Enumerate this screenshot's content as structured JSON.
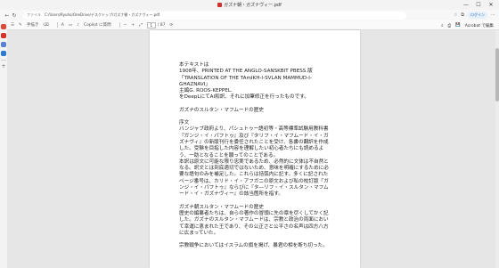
{
  "window": {
    "title": "ガズナ朝・ガズナヴィー.pdf",
    "controls": [
      "—",
      "☐",
      "✕"
    ]
  },
  "address": {
    "label": "ファイル",
    "url": "C:/Users/Ryuho/OneDrive/デスクトップ/ガズナ朝・ガズナヴィー.pdf",
    "login_label": "ログイン"
  },
  "toolbar": {
    "highlight": "手描き",
    "page_current": "1",
    "page_total": "/ 87",
    "zoom_minus": "−",
    "zoom_plus": "+",
    "copilot": "Copilot に質問",
    "acrobat": "Acrobat で編集"
  },
  "document": {
    "lines": [
      "本テキストは",
      "1908年、PRINTED AT THE ANGLO-SANSKBIT PBESS.版",
      "「TRANSLATION OF THE TAmIKH-I-SVLAN MAMMUD-I-GHAZNAVI」",
      "主編G. ROOS-KEPPEL.",
      "をDeepLにてAI和訳、それに加筆修正を行ったものです。",
      "",
      "ガズナのスルタン・マフムードの歴史",
      "",
      "序文",
      "バンジャブ政府より、パシュトゥー語初等・高等標準試験用教科書『ガンジ・イ・パフトゥ』及び『タリフ・イ・マフムード・イ・ガズナヴィ』の新版刊行を委任されたことを受け、各書の翻訳を作成した。受験を目指した内容を理解したい初心者たちにも読めるよう、一助となることを願ってのことである。",
      "本訳は原文に可能な限り忠実であるため、必然的に文体は不自然となる。訳文とは到底適切ではないため、意味を明確にするために必要な語句のみを補足した。これらは括弧内に記す。多くに記されたページ番号は、カリド・イ・アフガニの原文および私の校訂版『ガンジ・イ・パフトゥ』ならびに『タ―リフ・イ・スルタン・マフムード・イ・ガズナヴィー』の該当箇所を指す。",
      "",
      "ガズナ朝スルタン・マフムードの歴史",
      "歴史の編纂者たちは、自らの著作の冒頭に先の章を尽くしてかく記した。ガズナのスルタン・マフムードは、宗教と政治の両面において幸運に恵まれた王であり、その公正さと公平さの名声は四方八方に広まっていた。",
      "",
      "宗教戦争においてはイスラムの旗を掲げ、暴君の相を断ち切った。"
    ]
  }
}
